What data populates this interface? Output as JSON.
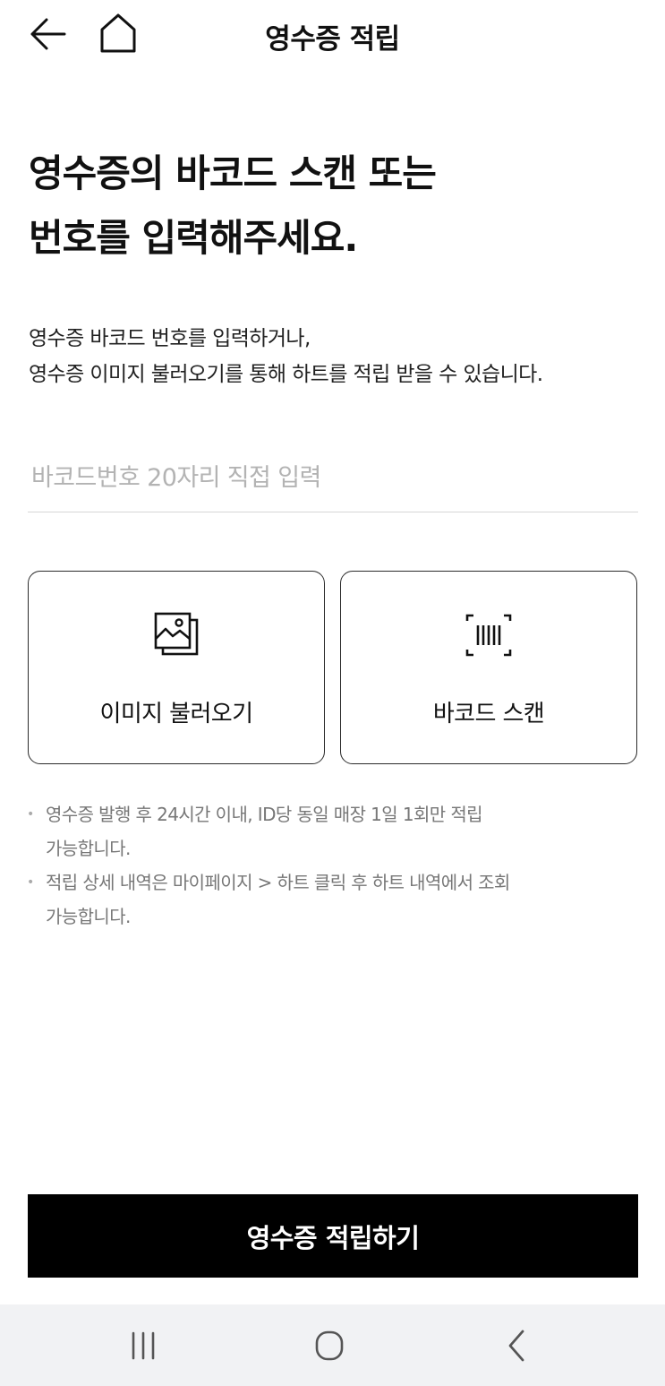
{
  "header": {
    "title": "영수증 적립",
    "back_icon": "arrow-left-icon",
    "home_icon": "home-icon"
  },
  "headline": {
    "line1": "영수증의 바코드 스캔 또는",
    "line2": "번호를 입력해주세요."
  },
  "description": {
    "line1": "영수증 바코드 번호를 입력하거나,",
    "line2": "영수증 이미지 불러오기를 통해 하트를 적립 받을 수 있습니다."
  },
  "barcode_input": {
    "value": "",
    "placeholder": "바코드번호 20자리 직접 입력"
  },
  "actions": {
    "image_load": {
      "label": "이미지 불러오기",
      "icon": "image-gallery-icon"
    },
    "barcode_scan": {
      "label": "바코드 스캔",
      "icon": "barcode-scan-icon"
    }
  },
  "notes": {
    "bullet": "•",
    "note1": {
      "line1": "영수증 발행 후 24시간 이내, ID당 동일 매장 1일 1회만 적립",
      "line2": "가능합니다."
    },
    "note2": {
      "line1": "적립 상세 내역은 마이페이지 > 하트 클릭 후 하트 내역에서 조회",
      "line2": "가능합니다."
    }
  },
  "submit": {
    "label": "영수증 적립하기"
  },
  "navbar": {
    "recent_icon": "recent-apps-icon",
    "home_icon": "home-circle-icon",
    "back_icon": "chevron-left-icon"
  },
  "colors": {
    "primary_button_bg": "#000000",
    "primary_button_text": "#ffffff",
    "placeholder": "#b3b3b3",
    "note_text": "#777777",
    "navbar_bg": "#f1f2f4"
  }
}
